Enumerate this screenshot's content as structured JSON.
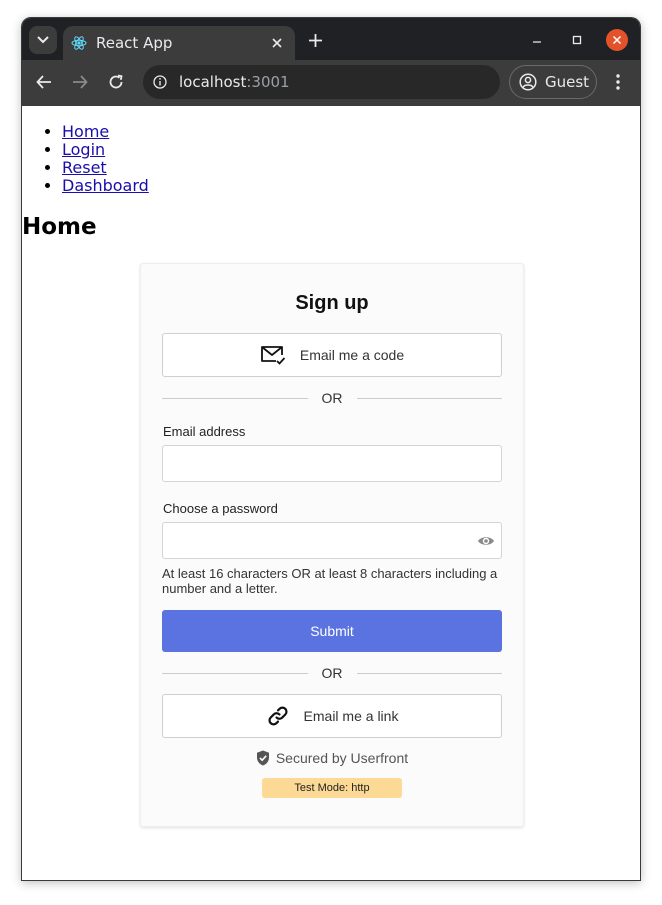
{
  "browser": {
    "tab_title": "React App",
    "url_host": "localhost",
    "url_port": ":3001",
    "profile_name": "Guest"
  },
  "nav": {
    "links": [
      "Home",
      "Login",
      "Reset",
      "Dashboard"
    ]
  },
  "page": {
    "title": "Home"
  },
  "signup": {
    "title": "Sign up",
    "email_code_label": "Email me a code",
    "or_label": "OR",
    "email_label": "Email address",
    "email_value": "",
    "password_label": "Choose a password",
    "password_value": "",
    "password_hint": "At least 16 characters OR at least 8 characters including a number and a letter.",
    "submit_label": "Submit",
    "email_link_label": "Email me a link",
    "secured_label": "Secured by Userfront",
    "test_mode_label": "Test Mode: http"
  },
  "colors": {
    "primary": "#5a73e0",
    "test_badge": "#fdd996",
    "link": "#1a0dab",
    "window_close": "#e2532c"
  },
  "icons": {
    "tab_favicon": "react-icon",
    "email_code": "mail-check-icon",
    "email_link": "link-icon",
    "secured": "shield-check-icon",
    "password_toggle": "eye-icon"
  }
}
